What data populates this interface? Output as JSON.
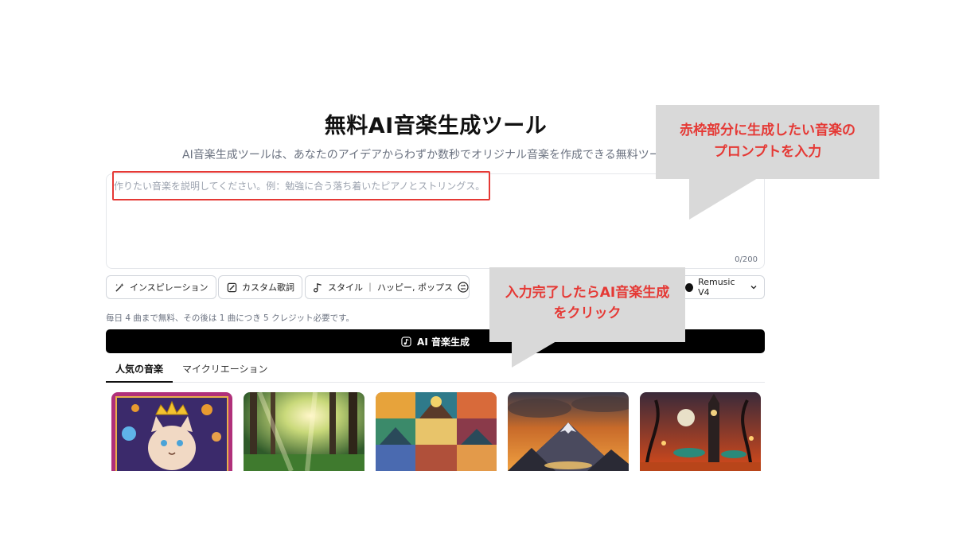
{
  "header": {
    "title": "無料AI音楽生成ツール",
    "subtitle": "AI音楽生成ツールは、あなたのアイデアからわずか数秒でオリジナル音楽を作成できる無料ツール"
  },
  "prompt": {
    "placeholder": "作りたい音楽を説明してください。例：勉強に合う落ち着いたピアノとストリングス。",
    "value": "",
    "char_count": "0/200"
  },
  "options": {
    "inspiration": "インスピレーション",
    "custom_lyrics": "カスタム歌詞",
    "style": "スタイル ｜ ハッピー, ポップス",
    "model": "Remusic V4"
  },
  "note": "毎日 4 曲まで無料、その後は 1 曲につき 5 クレジット必要です。",
  "generate_label": "AI 音楽生成",
  "tabs": [
    {
      "label": "人気の音楽",
      "active": true
    },
    {
      "label": "マイクリエーション",
      "active": false
    }
  ],
  "annotations": {
    "callout_prompt": "赤枠部分に生成したい音楽の\nプロンプトを入力",
    "callout_generate": "入力完了したらAI音楽生成\nをクリック",
    "highlight_color": "#e53935",
    "callout_bg": "#d9d9d9"
  },
  "thumbnails": [
    {
      "name": "cat-king-thumbnail"
    },
    {
      "name": "forest-sunlight-thumbnail"
    },
    {
      "name": "collage-thumbnail"
    },
    {
      "name": "mountain-sunset-thumbnail"
    },
    {
      "name": "night-city-thumbnail"
    }
  ]
}
